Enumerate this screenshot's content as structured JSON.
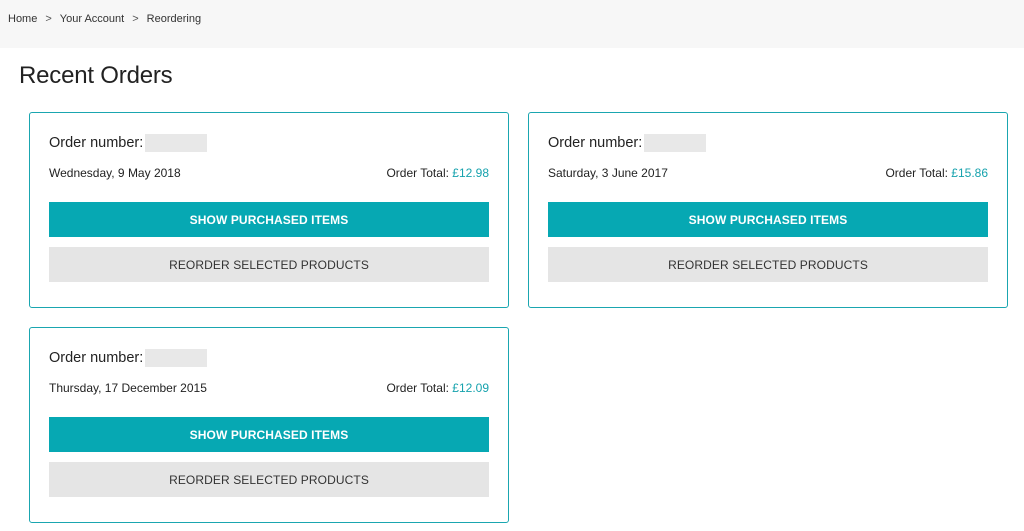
{
  "breadcrumb": {
    "items": [
      "Home",
      "Your Account",
      "Reordering"
    ],
    "separator": ">"
  },
  "page_title": "Recent Orders",
  "colors": {
    "accent": "#06a8b3",
    "card_border": "#1aa6b0",
    "secondary_button": "#e5e5e5",
    "breadcrumb_bg": "#f7f7f7"
  },
  "orders": [
    {
      "number_label": "Order number:",
      "number_value": "",
      "date": "Wednesday, 9 May 2018",
      "total_label": "Order Total:",
      "total_amount": "£12.98",
      "show_items_label": "SHOW PURCHASED ITEMS",
      "reorder_label": "REORDER SELECTED PRODUCTS"
    },
    {
      "number_label": "Order number:",
      "number_value": "",
      "date": "Saturday, 3 June 2017",
      "total_label": "Order Total:",
      "total_amount": "£15.86",
      "show_items_label": "SHOW PURCHASED ITEMS",
      "reorder_label": "REORDER SELECTED PRODUCTS"
    },
    {
      "number_label": "Order number:",
      "number_value": "",
      "date": "Thursday, 17 December 2015",
      "total_label": "Order Total:",
      "total_amount": "£12.09",
      "show_items_label": "SHOW PURCHASED ITEMS",
      "reorder_label": "REORDER SELECTED PRODUCTS"
    }
  ]
}
